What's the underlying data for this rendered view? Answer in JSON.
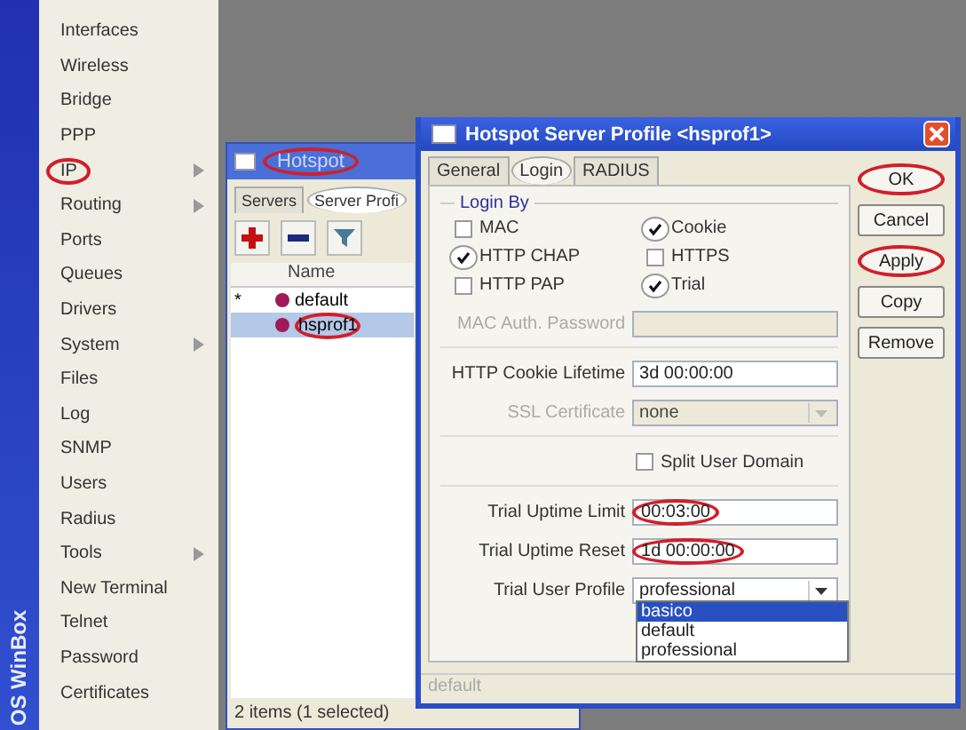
{
  "sidebar": {
    "brand": "OS WinBox",
    "items": [
      {
        "label": "Interfaces",
        "submenu": false,
        "circled": false
      },
      {
        "label": "Wireless",
        "submenu": false,
        "circled": false
      },
      {
        "label": "Bridge",
        "submenu": false,
        "circled": false
      },
      {
        "label": "PPP",
        "submenu": false,
        "circled": false
      },
      {
        "label": "IP",
        "submenu": true,
        "circled": true
      },
      {
        "label": "Routing",
        "submenu": true,
        "circled": false
      },
      {
        "label": "Ports",
        "submenu": false,
        "circled": false
      },
      {
        "label": "Queues",
        "submenu": false,
        "circled": false
      },
      {
        "label": "Drivers",
        "submenu": false,
        "circled": false
      },
      {
        "label": "System",
        "submenu": true,
        "circled": false
      },
      {
        "label": "Files",
        "submenu": false,
        "circled": false
      },
      {
        "label": "Log",
        "submenu": false,
        "circled": false
      },
      {
        "label": "SNMP",
        "submenu": false,
        "circled": false
      },
      {
        "label": "Users",
        "submenu": false,
        "circled": false
      },
      {
        "label": "Radius",
        "submenu": false,
        "circled": false
      },
      {
        "label": "Tools",
        "submenu": true,
        "circled": false
      },
      {
        "label": "New Terminal",
        "submenu": false,
        "circled": false
      },
      {
        "label": "Telnet",
        "submenu": false,
        "circled": false
      },
      {
        "label": "Password",
        "submenu": false,
        "circled": false
      },
      {
        "label": "Certificates",
        "submenu": false,
        "circled": false
      }
    ]
  },
  "hotspot": {
    "title": "Hotspot",
    "title_circled": true,
    "tabs": [
      {
        "label": "Servers",
        "selected": false,
        "circled": false
      },
      {
        "label": "Server Profi",
        "selected": true,
        "circled": true
      }
    ],
    "columns": [
      "Name"
    ],
    "rows": [
      {
        "flag": "*",
        "name": "default",
        "selected": false,
        "circled": false
      },
      {
        "name": "hsprof1",
        "selected": true,
        "circled": true
      }
    ],
    "status": "2 items (1 selected)"
  },
  "dialog": {
    "title": "Hotspot Server Profile <hsprof1>",
    "tabs": [
      {
        "label": "General",
        "selected": false,
        "circled": false
      },
      {
        "label": "Login",
        "selected": true,
        "circled": true
      },
      {
        "label": "RADIUS",
        "selected": false,
        "circled": false
      }
    ],
    "buttons": [
      {
        "label": "OK",
        "circled": true
      },
      {
        "label": "Cancel",
        "circled": false
      },
      {
        "label": "Apply",
        "circled": true
      },
      {
        "label": "Copy",
        "circled": false
      },
      {
        "label": "Remove",
        "circled": false
      }
    ],
    "login_by": {
      "title": "Login By",
      "options": [
        {
          "label": "MAC",
          "checked": false,
          "circled": false
        },
        {
          "label": "Cookie",
          "checked": true,
          "circled": true
        },
        {
          "label": "HTTP CHAP",
          "checked": true,
          "circled": true
        },
        {
          "label": "HTTPS",
          "checked": false,
          "circled": false
        },
        {
          "label": "HTTP PAP",
          "checked": false,
          "circled": false
        },
        {
          "label": "Trial",
          "checked": true,
          "circled": true
        }
      ]
    },
    "fields": [
      {
        "kind": "text",
        "label": "MAC Auth. Password",
        "disabled": true,
        "circled": false
      },
      {
        "kind": "text",
        "label": "HTTP Cookie Lifetime",
        "value": "3d 00:00:00",
        "disabled": false,
        "circled": false
      },
      {
        "kind": "select",
        "label": "SSL Certificate",
        "value": "none",
        "disabled": true,
        "open": false
      },
      {
        "kind": "checkbox",
        "label": "Split User Domain",
        "checked": false
      },
      {
        "kind": "text",
        "label": "Trial Uptime Limit",
        "value": "00:03:00",
        "disabled": false,
        "circled": true
      },
      {
        "kind": "text",
        "label": "Trial Uptime Reset",
        "value": "1d 00:00:00",
        "disabled": false,
        "circled": true
      },
      {
        "kind": "select",
        "label": "Trial User Profile",
        "value": "professional",
        "disabled": false,
        "open": true,
        "options": [
          {
            "label": "basico",
            "highlighted": true
          },
          {
            "label": "default",
            "highlighted": false
          },
          {
            "label": "professional",
            "highlighted": false
          }
        ]
      }
    ],
    "status": "default"
  }
}
